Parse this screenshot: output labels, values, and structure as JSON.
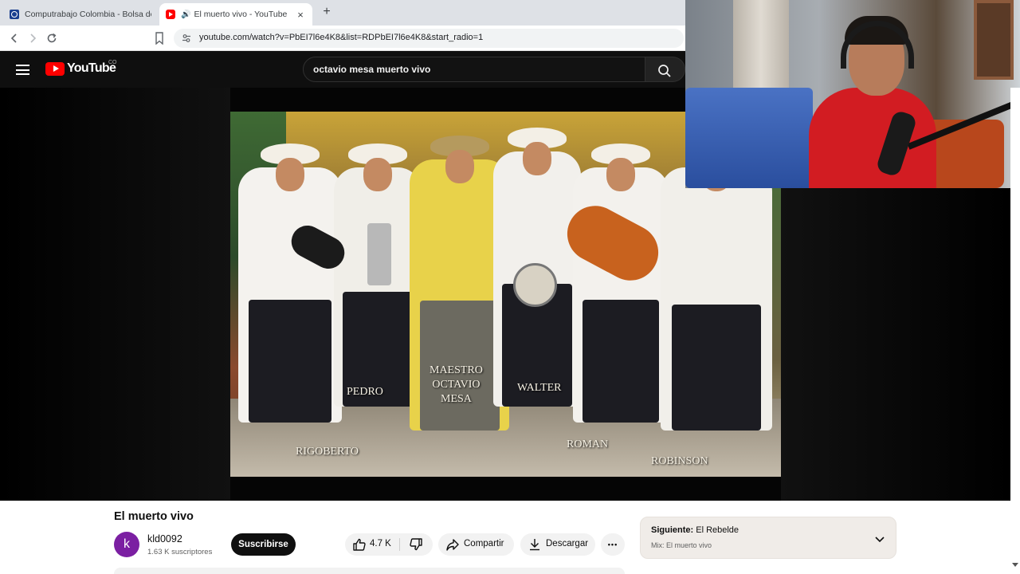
{
  "browser": {
    "tabs": [
      {
        "title": "Computrabajo Colombia - Bolsa de t",
        "active": false
      },
      {
        "title": "El muerto vivo - YouTube",
        "active": true
      }
    ],
    "new_tab_symbol": "+",
    "close_symbol": "×",
    "url": "youtube.com/watch?v=PbEI7l6e4K8&list=RDPbEI7l6e4K8&start_radio=1"
  },
  "youtube": {
    "logo_text": "YouTube",
    "region": "CO",
    "search_query": "octavio mesa muerto vivo"
  },
  "video": {
    "overlay_names": [
      {
        "id": "rigoberto",
        "text": "RIGOBERTO"
      },
      {
        "id": "pedro",
        "text": "PEDRO"
      },
      {
        "id": "maestro",
        "text": "MAESTRO\nOCTAVIO\nMESA"
      },
      {
        "id": "walter",
        "text": "WALTER"
      },
      {
        "id": "roman",
        "text": "ROMAN"
      },
      {
        "id": "robinson",
        "text": "ROBINSON"
      }
    ],
    "title": "El muerto vivo",
    "channel": {
      "avatar_letter": "k",
      "name": "kld0092",
      "subscribers": "1.63 K suscriptores",
      "subscribe_label": "Suscribirse"
    },
    "actions": {
      "likes": "4.7 K",
      "share_label": "Compartir",
      "download_label": "Descargar",
      "more_symbol": "•••"
    }
  },
  "up_next": {
    "prefix": "Siguiente:",
    "title": "El Rebelde",
    "mix": "Mix: El muerto vivo"
  },
  "colors": {
    "youtube_red": "#ff0000",
    "header_bg": "#0f0f0f",
    "subscribe_bg": "#0f0f0f",
    "avatar_bg": "#7b1fa2",
    "next_card_bg": "#f0ece8"
  }
}
